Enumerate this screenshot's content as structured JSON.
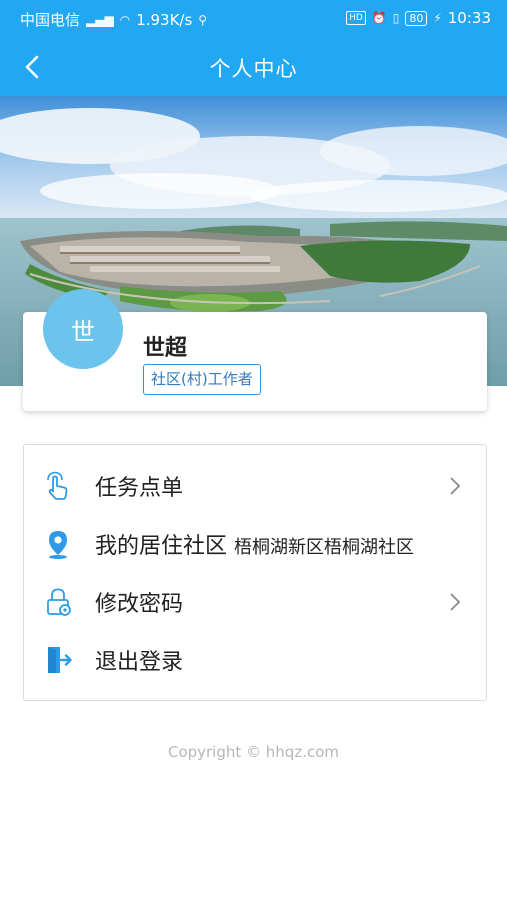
{
  "status_bar": {
    "carrier": "中国电信",
    "network_speed": "1.93K/s",
    "battery": "80",
    "time": "10:33"
  },
  "header": {
    "title": "个人中心"
  },
  "profile": {
    "avatar_text": "世",
    "name": "世超",
    "role": "社区(村)工作者"
  },
  "menu": {
    "items": [
      {
        "label": "任务点单",
        "value": "",
        "icon": "hand-pointer-icon"
      },
      {
        "label": "我的居住社区",
        "value": "梧桐湖新区梧桐湖社区",
        "icon": "location-pin-icon"
      },
      {
        "label": "修改密码",
        "value": "",
        "icon": "lock-gear-icon"
      },
      {
        "label": "退出登录",
        "value": "",
        "icon": "logout-door-icon"
      }
    ]
  },
  "footer": {
    "copyright": "Copyright © hhqz.com"
  },
  "colors": {
    "primary": "#22a8f2",
    "icon": "#2f9be6",
    "avatar": "#6cc4ec"
  }
}
